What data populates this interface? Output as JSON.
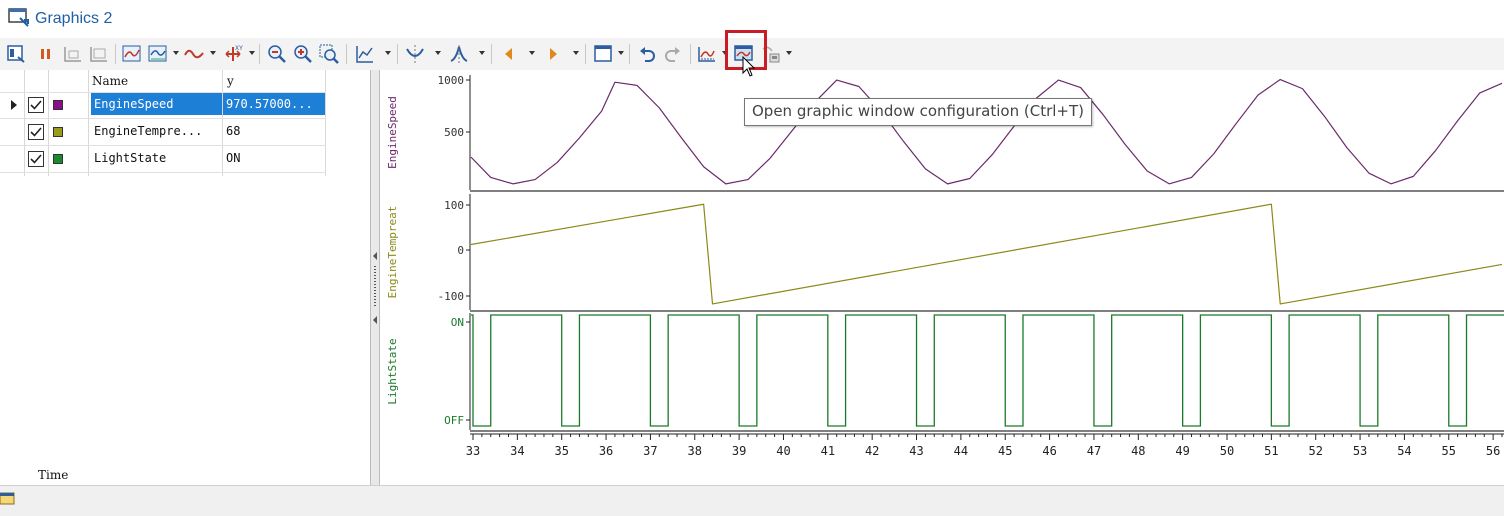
{
  "window": {
    "title": "Graphics 2"
  },
  "toolbar": {
    "tooltip": "Open graphic window configuration (Ctrl+T)",
    "buttons": [
      {
        "name": "signal-list-icon"
      },
      {
        "name": "pause-icon"
      },
      {
        "name": "fit-width-icon"
      },
      {
        "name": "fit-all-icon"
      },
      {
        "name": "graph-layout-icon"
      },
      {
        "name": "graph-style-icon"
      },
      {
        "name": "waveform-icon"
      },
      {
        "name": "xy-mode-icon"
      },
      {
        "name": "zoom-in-icon"
      },
      {
        "name": "zoom-out-icon"
      },
      {
        "name": "zoom-box-icon"
      },
      {
        "name": "chart-type-icon"
      },
      {
        "name": "cursor-measure-icon"
      },
      {
        "name": "peak-icon"
      },
      {
        "name": "previous-marker-icon"
      },
      {
        "name": "next-marker-icon"
      },
      {
        "name": "window-frame-icon"
      },
      {
        "name": "undo-icon"
      },
      {
        "name": "redo-icon"
      },
      {
        "name": "export-icon"
      },
      {
        "name": "graphic-window-config-icon"
      },
      {
        "name": "print-icon"
      }
    ]
  },
  "signals": {
    "columns": {
      "name": "Name",
      "y": "y"
    },
    "rows": [
      {
        "name": "EngineSpeed",
        "value": "970.57000...",
        "color": "#8b0f8b",
        "checked": true,
        "selected": true
      },
      {
        "name": "EngineTempre...",
        "value": "68",
        "color": "#9a9a1e",
        "checked": true,
        "selected": false
      },
      {
        "name": "LightState",
        "value": "ON",
        "color": "#1b8a2c",
        "checked": true,
        "selected": false
      }
    ],
    "footer_label": "Time"
  },
  "chart_data": [
    {
      "type": "line",
      "ylabel": "EngineSpeed",
      "color": "#6b2a6b",
      "yticks": [
        "1000",
        "500"
      ],
      "ylim": [
        0,
        1000
      ],
      "x": [
        32.9,
        33.4,
        33.9,
        34.4,
        34.9,
        35.4,
        35.9,
        36.2,
        36.7,
        37.2,
        37.7,
        38.2,
        38.7,
        39.2,
        39.7,
        40.2,
        40.7,
        41.2,
        41.7,
        42.2,
        42.7,
        43.2,
        43.7,
        44.2,
        44.7,
        45.2,
        45.7,
        46.2,
        46.7,
        47.2,
        47.7,
        48.2,
        48.7,
        49.2,
        49.7,
        50.2,
        50.7,
        51.2,
        51.7,
        52.2,
        52.7,
        53.2,
        53.7,
        54.2,
        54.7,
        55.2,
        55.7,
        56.2
      ],
      "y": [
        270,
        80,
        20,
        60,
        220,
        450,
        700,
        970,
        940,
        730,
        450,
        180,
        20,
        60,
        260,
        520,
        780,
        990,
        930,
        700,
        420,
        160,
        20,
        70,
        290,
        560,
        820,
        990,
        920,
        670,
        390,
        140,
        20,
        80,
        300,
        580,
        850,
        995,
        910,
        650,
        360,
        120,
        20,
        90,
        330,
        610,
        870,
        960
      ]
    },
    {
      "type": "line",
      "ylabel": "EngineTempreat",
      "color": "#8a8a1a",
      "yticks": [
        "100",
        "0",
        "-100"
      ],
      "ylim": [
        -130,
        130
      ],
      "x": [
        32.9,
        38.2,
        38.4,
        51.0,
        51.2,
        56.2
      ],
      "y": [
        18,
        115,
        -125,
        115,
        -125,
        -30
      ]
    },
    {
      "type": "line",
      "ylabel": "LightState",
      "color": "#1b7a2a",
      "yticks": [
        "ON",
        "OFF"
      ],
      "ylim": [
        0,
        1
      ],
      "step_edges": [
        33.0,
        33.4,
        35.0,
        35.4,
        37.0,
        37.4,
        39.0,
        39.4,
        41.0,
        41.4,
        43.0,
        43.4,
        45.0,
        45.4,
        47.0,
        47.4,
        49.0,
        49.4,
        51.0,
        51.4,
        53.0,
        53.4,
        55.0,
        55.4
      ],
      "start_state": "ON",
      "x_ticks": [
        "33",
        "34",
        "35",
        "36",
        "37",
        "38",
        "39",
        "40",
        "41",
        "42",
        "43",
        "44",
        "45",
        "46",
        "47",
        "48",
        "49",
        "50",
        "51",
        "52",
        "53",
        "54",
        "55",
        "56"
      ],
      "xlim": [
        33,
        56.2
      ]
    }
  ]
}
